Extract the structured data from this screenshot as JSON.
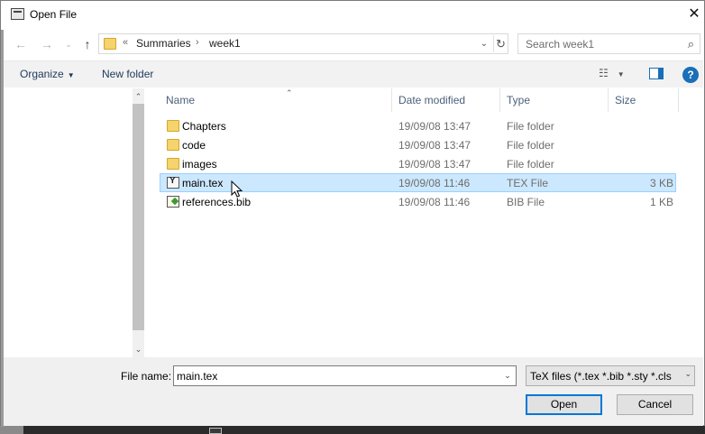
{
  "window": {
    "title": "Open File"
  },
  "address": {
    "overflow": "«",
    "segments": [
      "Summaries",
      "week1"
    ]
  },
  "search": {
    "placeholder": "Search week1"
  },
  "toolbar": {
    "organize_label": "Organize",
    "new_folder_label": "New folder"
  },
  "columns": {
    "name": "Name",
    "date": "Date modified",
    "type": "Type",
    "size": "Size"
  },
  "files": [
    {
      "name": "Chapters",
      "date": "19/09/08 13:47",
      "type": "File folder",
      "size": "",
      "icon": "folder-icon"
    },
    {
      "name": "code",
      "date": "19/09/08 13:47",
      "type": "File folder",
      "size": "",
      "icon": "folder-icon"
    },
    {
      "name": "images",
      "date": "19/09/08 13:47",
      "type": "File folder",
      "size": "",
      "icon": "folder-icon"
    },
    {
      "name": "main.tex",
      "date": "19/09/08 11:46",
      "type": "TEX File",
      "size": "3 KB",
      "icon": "tex-file-icon",
      "selected": true
    },
    {
      "name": "references.bib",
      "date": "19/09/08 11:46",
      "type": "BIB File",
      "size": "1 KB",
      "icon": "bib-file-icon"
    }
  ],
  "bottom": {
    "file_name_label": "File name:",
    "file_name_value": "main.tex",
    "file_type": "TeX files (*.tex *.bib *.sty *.cls *.",
    "open_label": "Open",
    "cancel_label": "Cancel"
  },
  "colors": {
    "selection": "#cce8ff",
    "accent": "#0078d7",
    "folder": "#f5d36d"
  }
}
